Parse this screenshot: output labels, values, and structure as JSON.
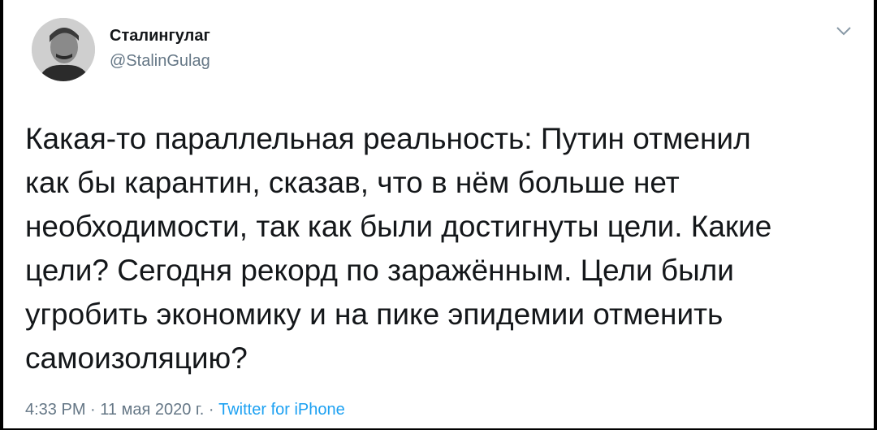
{
  "tweet": {
    "author": {
      "display_name": "Сталингулаг",
      "handle": "@StalinGulag",
      "avatar_icon": "avatar-portrait-icon"
    },
    "menu_icon": "chevron-down-icon",
    "text": "Какая-то параллельная реальность: Путин отменил\nкак бы карантин, сказав, что в нём больше нет\nнеобходимости, так как были достигнуты цели. Какие\nцели? Сегодня рекорд по заражённым. Цели были\nугробить экономику и на пике эпидемии отменить\nсамоизоляцию?",
    "time": "4:33 PM",
    "separator": "·",
    "date": "11 мая 2020 г.",
    "source": "Twitter for iPhone"
  },
  "colors": {
    "text": "#14171a",
    "secondary": "#657786",
    "link": "#1da1f2",
    "background": "#ffffff"
  }
}
